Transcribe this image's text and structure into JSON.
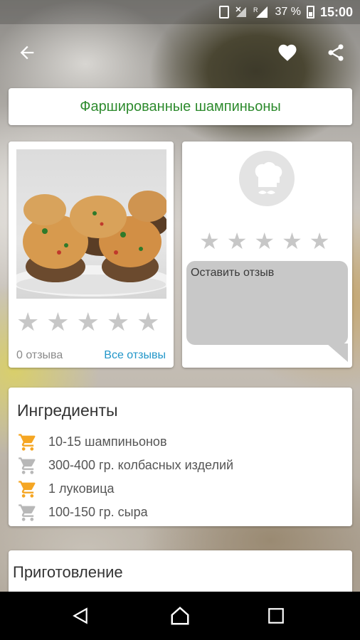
{
  "status_bar": {
    "battery_percent": "37 %",
    "time": "15:00",
    "signal_badge": "R"
  },
  "app_bar": {
    "back_icon": "arrow-left-icon",
    "favorite_icon": "heart-icon",
    "share_icon": "share-icon"
  },
  "recipe": {
    "title": "Фаршированные шампиньоны",
    "rating_stars": 5,
    "reviews_count": "0 отзыва",
    "all_reviews_link": "Все отзывы"
  },
  "review_form": {
    "avatar_icon": "chef-icon",
    "rating_stars": 5,
    "placeholder": "Оставить отзыв"
  },
  "ingredients": {
    "title": "Ингредиенты",
    "items": [
      {
        "text": "10-15 шампиньонов",
        "cart_color": "#f5a623"
      },
      {
        "text": "300-400 гр. колбасных изделий",
        "cart_color": "#b8b8b8"
      },
      {
        "text": "1 луковица",
        "cart_color": "#f5a623"
      },
      {
        "text": "100-150 гр. сыра",
        "cart_color": "#b8b8b8"
      }
    ]
  },
  "preparation": {
    "title": "Приготовление"
  },
  "colors": {
    "title_green": "#2e8b2e",
    "link_blue": "#2196c9",
    "star_grey": "#c7c7c7"
  }
}
